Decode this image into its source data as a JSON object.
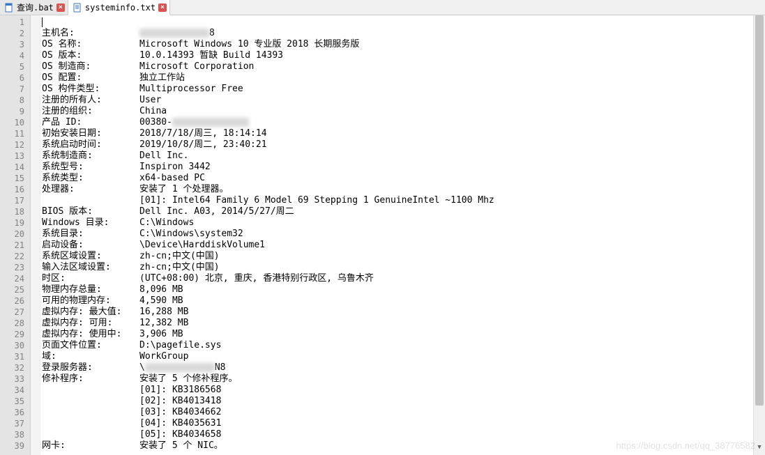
{
  "tabs": [
    {
      "label": "查询.bat",
      "active": false
    },
    {
      "label": "systeminfo.txt",
      "active": true
    }
  ],
  "gutter_start": 1,
  "gutter_end": 39,
  "content": {
    "lines": [
      {
        "key": "",
        "val": ""
      },
      {
        "key": "主机名:",
        "val": "",
        "redact_before": 100,
        "tail": "8"
      },
      {
        "key": "OS 名称:",
        "val": "Microsoft Windows 10 专业版 2018 长期服务版"
      },
      {
        "key": "OS 版本:",
        "val": "10.0.14393 暂缺 Build 14393"
      },
      {
        "key": "OS 制造商:",
        "val": "Microsoft Corporation"
      },
      {
        "key": "OS 配置:",
        "val": "独立工作站"
      },
      {
        "key": "OS 构件类型:",
        "val": "Multiprocessor Free"
      },
      {
        "key": "注册的所有人:",
        "val": "User"
      },
      {
        "key": "注册的组织:",
        "val": "China"
      },
      {
        "key": "产品 ID:",
        "val": "00380-",
        "redact_after": 110
      },
      {
        "key": "初始安装日期:",
        "val": "2018/7/18/周三, 18:14:14"
      },
      {
        "key": "系统启动时间:",
        "val": "2019/10/8/周二, 23:40:21"
      },
      {
        "key": "系统制造商:",
        "val": "Dell Inc."
      },
      {
        "key": "系统型号:",
        "val": "Inspiron 3442"
      },
      {
        "key": "系统类型:",
        "val": "x64-based PC"
      },
      {
        "key": "处理器:",
        "val": "安装了 1 个处理器。"
      },
      {
        "key": "",
        "val": "[01]: Intel64 Family 6 Model 69 Stepping 1 GenuineIntel ~1100 Mhz"
      },
      {
        "key": "BIOS 版本:",
        "val": "Dell Inc. A03, 2014/5/27/周二"
      },
      {
        "key": "Windows 目录:",
        "val": "C:\\Windows"
      },
      {
        "key": "系统目录:",
        "val": "C:\\Windows\\system32"
      },
      {
        "key": "启动设备:",
        "val": "\\Device\\HarddiskVolume1"
      },
      {
        "key": "系统区域设置:",
        "val": "zh-cn;中文(中国)"
      },
      {
        "key": "输入法区域设置:",
        "val": "zh-cn;中文(中国)"
      },
      {
        "key": "时区:",
        "val": "(UTC+08:00) 北京, 重庆, 香港特别行政区, 乌鲁木齐"
      },
      {
        "key": "物理内存总量:",
        "val": "8,096 MB"
      },
      {
        "key": "可用的物理内存:",
        "val": "4,590 MB"
      },
      {
        "key": "虚拟内存: 最大值:",
        "val": "16,288 MB"
      },
      {
        "key": "虚拟内存: 可用:",
        "val": "12,382 MB"
      },
      {
        "key": "虚拟内存: 使用中:",
        "val": "3,906 MB"
      },
      {
        "key": "页面文件位置:",
        "val": "D:\\pagefile.sys"
      },
      {
        "key": "域:",
        "val": "WorkGroup"
      },
      {
        "key": "登录服务器:",
        "val": "\\",
        "redact_after": 100,
        "tail": "N8"
      },
      {
        "key": "修补程序:",
        "val": "安装了 5 个修补程序。"
      },
      {
        "key": "",
        "val": "[01]: KB3186568"
      },
      {
        "key": "",
        "val": "[02]: KB4013418"
      },
      {
        "key": "",
        "val": "[03]: KB4034662"
      },
      {
        "key": "",
        "val": "[04]: KB4035631"
      },
      {
        "key": "",
        "val": "[05]: KB4034658"
      },
      {
        "key": "网卡:",
        "val": "安装了 5 个 NIC。"
      }
    ]
  },
  "watermark": "https://blog.csdn.net/qq_38776582",
  "icons": {
    "file_bat_color": "#3b78c4",
    "file_txt_color": "#3b78c4"
  }
}
